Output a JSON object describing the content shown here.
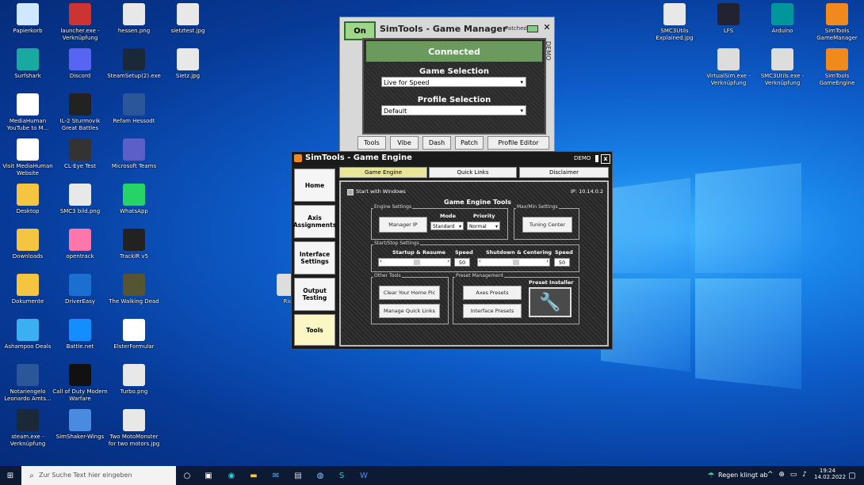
{
  "desktop": {
    "icons": [
      {
        "label": "Papierkorb",
        "icon": "recycle-bin-icon"
      },
      {
        "label": "launcher.exe - Verknüpfung",
        "icon": "launcher-icon"
      },
      {
        "label": "hessen.png",
        "icon": "image-file-icon"
      },
      {
        "label": "sietztest.jpg",
        "icon": "image-file-icon"
      },
      {
        "label": "Surfshark",
        "icon": "surfshark-icon"
      },
      {
        "label": "Discord",
        "icon": "discord-icon"
      },
      {
        "label": "SteamSetup(2).exe",
        "icon": "steam-setup-icon"
      },
      {
        "label": "Sietz.jpg",
        "icon": "image-file-icon"
      },
      {
        "label": "MediaHuman YouTube to M...",
        "icon": "mediahuman-icon"
      },
      {
        "label": "IL-2 Sturmovik Great Battles",
        "icon": "il2-icon"
      },
      {
        "label": "Refam Hessodt",
        "icon": "word-icon"
      },
      {
        "label": "Visit MediaHuman Website",
        "icon": "mediahuman-icon"
      },
      {
        "label": "CL-Eye Test",
        "icon": "camera-icon"
      },
      {
        "label": "Microsoft Teams",
        "icon": "teams-icon"
      },
      {
        "label": "Desktop",
        "icon": "folder-icon"
      },
      {
        "label": "SMC3 bild.png",
        "icon": "image-file-icon"
      },
      {
        "label": "WhatsApp",
        "icon": "whatsapp-icon"
      },
      {
        "label": "Downloads",
        "icon": "folder-icon"
      },
      {
        "label": "opentrack",
        "icon": "opentrack-icon"
      },
      {
        "label": "TrackIR v5",
        "icon": "trackir-icon"
      },
      {
        "label": "Dokumente",
        "icon": "folder-icon"
      },
      {
        "label": "DriverEasy",
        "icon": "drivereasy-icon"
      },
      {
        "label": "The Walking Dead",
        "icon": "walkingdead-icon"
      },
      {
        "label": "Ashampoo Deals",
        "icon": "ashampoo-icon"
      },
      {
        "label": "Battle.net",
        "icon": "battlenet-icon"
      },
      {
        "label": "ElsterFormular",
        "icon": "elster-icon"
      },
      {
        "label": "Notariengelo Leonardo Amts...",
        "icon": "word-icon"
      },
      {
        "label": "Call of Duty Modern Warfare",
        "icon": "cod-icon"
      },
      {
        "label": "Turbo.png",
        "icon": "image-file-icon"
      },
      {
        "label": "steam.exe - Verknüpfung",
        "icon": "steam-icon"
      },
      {
        "label": "SimShaker-Wings",
        "icon": "simshaker-icon"
      },
      {
        "label": "Two MotoMonster for two motors.jpg",
        "icon": "image-file-icon"
      },
      {
        "label": "SMC3Utils Explained.jpg",
        "icon": "image-file-icon"
      },
      {
        "label": "LFS",
        "icon": "lfs-icon"
      },
      {
        "label": "Arduino",
        "icon": "arduino-icon"
      },
      {
        "label": "SimTools GameManager",
        "icon": "simtools-icon"
      },
      {
        "label": "VirtualSim.exe - Verknüpfung",
        "icon": "app-icon"
      },
      {
        "label": "SMC3Utils.exe - Verknüpfung",
        "icon": "app-icon"
      },
      {
        "label": "SimTools GameEngine",
        "icon": "simtools-icon"
      },
      {
        "label": "Ric",
        "icon": "app-icon"
      }
    ]
  },
  "game_manager": {
    "on_label": "On",
    "title": "SimTools - Game Manager",
    "patched_label": "Patched",
    "close": "✕",
    "status": "Connected",
    "demo": "DEMO",
    "game_selection_label": "Game Selection",
    "game_selection_value": "Live for Speed",
    "profile_selection_label": "Profile Selection",
    "profile_selection_value": "Default",
    "tabs": [
      "Tools",
      "Vibe",
      "Dash",
      "Patch",
      "Profile Editor"
    ]
  },
  "game_engine": {
    "title": "SimTools - Game Engine",
    "demo": "DEMO",
    "close": "x",
    "side_tabs": [
      "Home",
      "Axis Assignments",
      "Interface Settings",
      "Output Testing",
      "Tools"
    ],
    "top_tabs": [
      "Game Engine",
      "Quick Links",
      "Disclaimer"
    ],
    "start_with_windows": "Start with Windows",
    "ip": "IP: 10.14.0.2",
    "section_title": "Game Engine Tools",
    "engine_settings": {
      "label": "Engine Settings",
      "manager_ip": "Manager IP",
      "mode_label": "Mode",
      "mode_value": "Standard",
      "priority_label": "Priority",
      "priority_value": "Normal"
    },
    "maxmin": {
      "label": "Max/Min Settings",
      "tuning": "Tuning Center"
    },
    "startstop": {
      "label": "Start/Stop Settings",
      "startup_label": "Startup & Resume",
      "startup_speed_label": "Speed",
      "startup_speed": "50",
      "shutdown_label": "Shutdown & Centering",
      "shutdown_speed_label": "Speed",
      "shutdown_speed": "50"
    },
    "other_tools": {
      "label": "Other Tools",
      "clear": "Clear Your Home Pic",
      "quick": "Manage Quick Links"
    },
    "preset": {
      "label": "Preset Management",
      "axes": "Axes Presets",
      "interface": "Interface Presets",
      "installer": "Preset Installer"
    }
  },
  "taskbar": {
    "search_placeholder": "Zur Suche Text hier eingeben",
    "weather": "Regen klingt ab",
    "time": "19:24",
    "date": "14.02.2022"
  }
}
